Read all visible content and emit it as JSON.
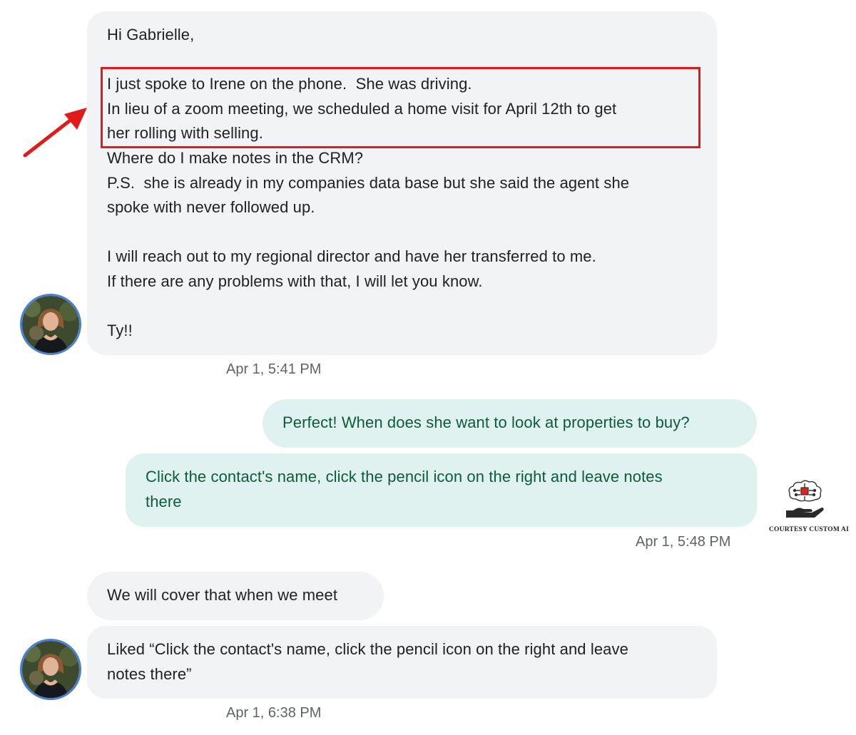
{
  "conversation": {
    "messages": [
      {
        "direction": "incoming",
        "lines": [
          "Hi Gabrielle,",
          "",
          "I just spoke to Irene on the phone.  She was driving.",
          "In lieu of a zoom meeting, we scheduled a home visit for April 12th to get",
          "her rolling with selling.",
          "Where do I make notes in the CRM?",
          "P.S.  she is already in my companies data base but she said the agent she",
          "spoke with never followed up.",
          "",
          "I will reach out to my regional director and have her transferred to me.",
          "If there are any problems with that, I will let you know.",
          "",
          "Ty!!"
        ],
        "timestamp": "Apr 1, 5:41 PM",
        "highlighted_lines": [
          2,
          4
        ]
      },
      {
        "direction": "outgoing",
        "lines": [
          "Perfect! When does she want to look at properties to buy?"
        ]
      },
      {
        "direction": "outgoing",
        "lines": [
          "Click the contact's name, click the pencil icon on the right and leave notes",
          "there"
        ],
        "timestamp": "Apr 1, 5:48 PM"
      },
      {
        "direction": "incoming",
        "lines": [
          "We will cover that when we meet"
        ]
      },
      {
        "direction": "incoming",
        "lines": [
          "Liked “Click the contact's name, click the pencil icon on the right and leave",
          "notes there”"
        ],
        "timestamp": "Apr 1, 6:38 PM"
      }
    ]
  },
  "annotation": {
    "color": "#e11b1b",
    "type": "red-box-with-arrow"
  },
  "watermark": {
    "caption": "COURTESY CUSTOM AI",
    "icon": "brain-on-hand-icon"
  },
  "colors": {
    "incoming_bubble": "#f1f3f4",
    "outgoing_bubble": "#e0f2ef",
    "outgoing_text": "#0d5a3e",
    "avatar_ring": "#4a7fd3"
  }
}
